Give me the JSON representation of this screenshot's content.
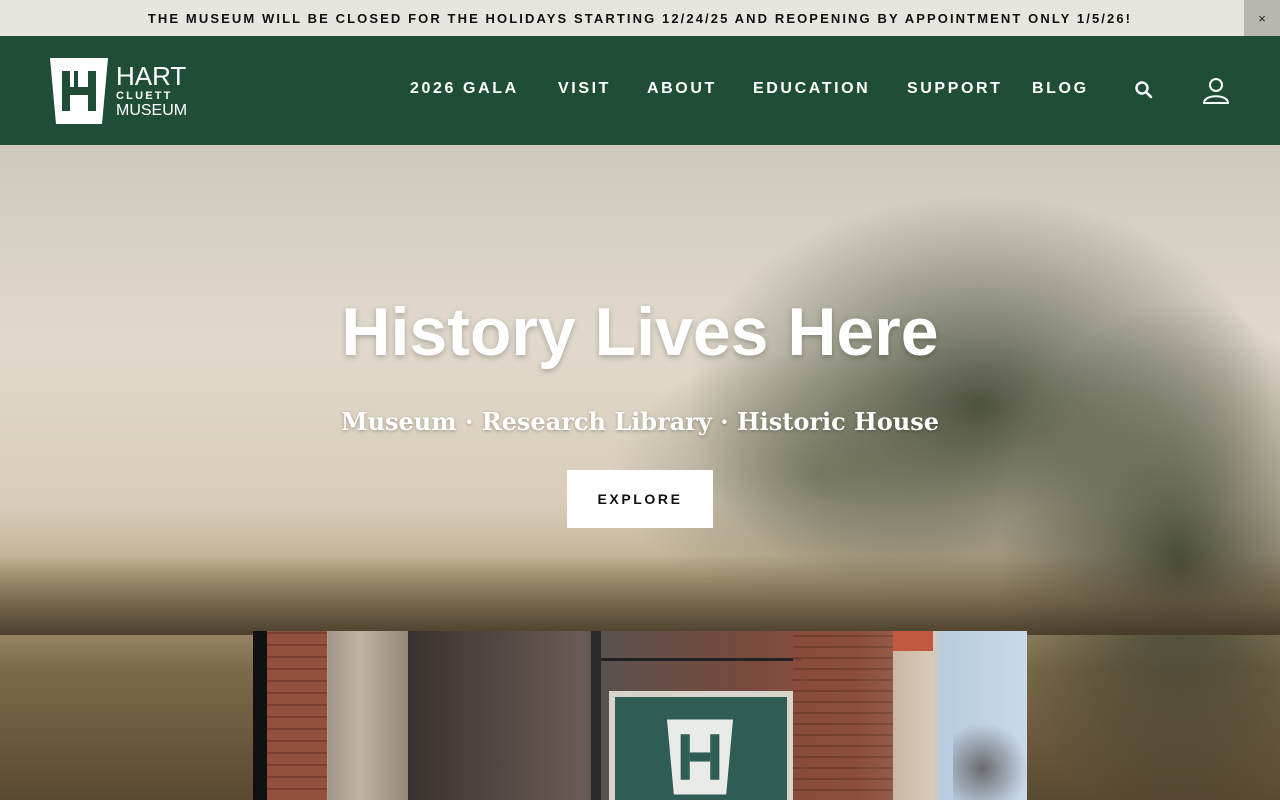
{
  "announcement": {
    "text": "THE MUSEUM WILL BE CLOSED FOR THE HOLIDAYS STARTING 12/24/25 AND REOPENING BY APPOINTMENT ONLY 1/5/26!",
    "close_label": "×"
  },
  "logo": {
    "line1": "HART",
    "line2": "CLUETT",
    "line3": "MUSEUM"
  },
  "nav": {
    "items": [
      {
        "label": "2026 GALA"
      },
      {
        "label": "VISIT"
      },
      {
        "label": "ABOUT"
      },
      {
        "label": "EDUCATION"
      },
      {
        "label": "SUPPORT"
      },
      {
        "label": "BLOG"
      }
    ],
    "search_icon": "search-icon",
    "account_icon": "user-icon"
  },
  "hero": {
    "title": "History Lives Here",
    "subtitle": "Museum · Research Library · Historic House",
    "cta_label": "EXPLORE"
  },
  "colors": {
    "header_green": "#1f4d37",
    "announcement_bg": "#e8e4df",
    "white": "#ffffff"
  }
}
